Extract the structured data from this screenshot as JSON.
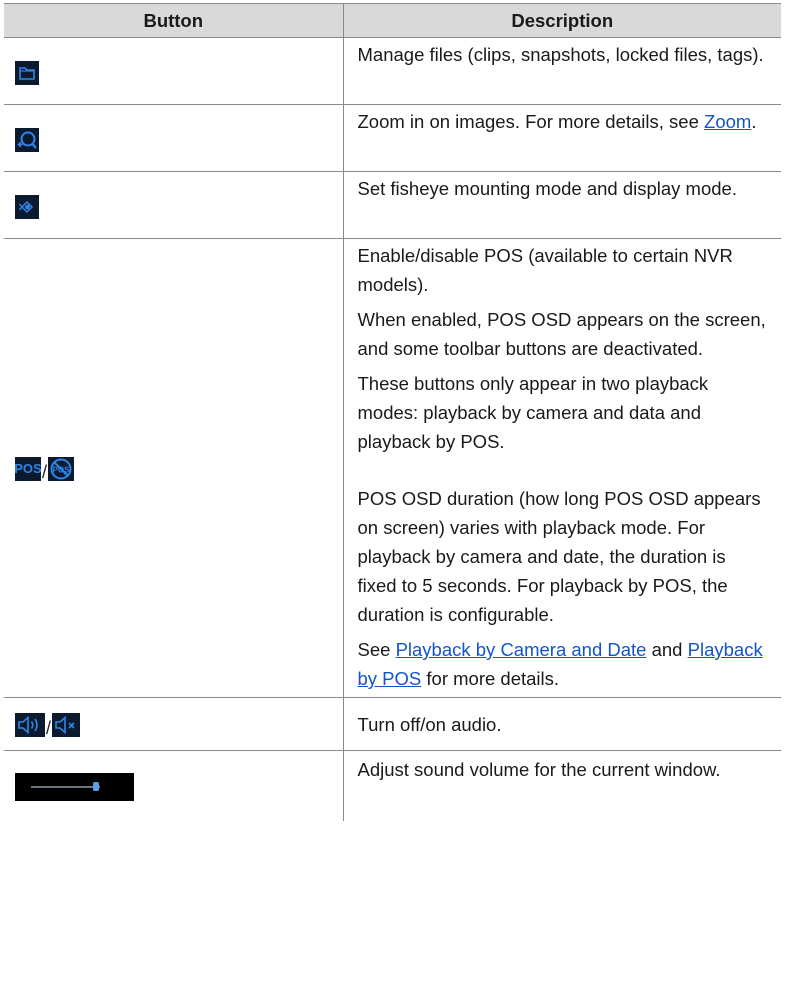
{
  "table": {
    "headers": [
      "Button",
      "Description"
    ],
    "rows": [
      {
        "icons": [
          "folder-icon"
        ],
        "desc": [
          "Manage files (clips, snapshots, locked files, tags)."
        ]
      },
      {
        "icons": [
          "zoom-in-icon"
        ],
        "desc_before_link": "Zoom in on images. For more details, see ",
        "desc_link": "Zoom",
        "desc_after_link": "."
      },
      {
        "icons": [
          "fisheye-icon"
        ],
        "desc": [
          "Set fisheye mounting mode and display mode."
        ]
      },
      {
        "icons": [
          "pos-enable-icon",
          "pos-disable-icon"
        ],
        "icon_labels": [
          "POS",
          "POS"
        ],
        "separator": "/",
        "paragraphs": [
          "Enable/disable POS (available to certain NVR models).",
          "When enabled, POS OSD appears on the screen, and some toolbar buttons are deactivated.",
          "These buttons only appear in two playback modes: playback by camera and data and playback by POS.",
          "POS OSD duration (how long POS OSD appears on screen) varies with playback mode. For playback by camera and date, the duration is fixed to 5 seconds. For playback by POS, the duration is configurable."
        ],
        "see_prefix": "See ",
        "see_link1": "Playback by Camera and Date",
        "see_middle": " and ",
        "see_link2": "Playback by POS",
        "see_suffix": " for more details."
      },
      {
        "icons": [
          "audio-on-icon",
          "audio-mute-icon"
        ],
        "separator": "/",
        "desc": [
          "Turn off/on audio."
        ]
      },
      {
        "icons": [
          "volume-slider"
        ],
        "volume_level": 0.72,
        "desc": [
          "Adjust sound volume for the current window."
        ]
      }
    ]
  },
  "colors": {
    "header_bg": "#d9d9d9",
    "icon_bg": "#0b1a2e",
    "icon_accent": "#2f86e6",
    "link": "#1155cc"
  }
}
